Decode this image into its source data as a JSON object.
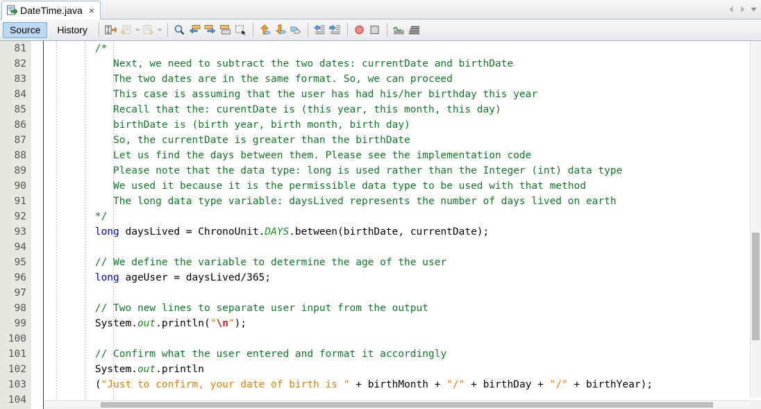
{
  "window": {
    "tab": {
      "label": "DateTime.java",
      "icon": "java-file-icon",
      "close_label": "×"
    },
    "tab_nav": {
      "prev_icon": "chevron-left-icon",
      "next_icon": "chevron-right-icon",
      "list_icon": "tab-list-chevron-icon"
    }
  },
  "toolbar": {
    "view_tabs": [
      {
        "label": "Source",
        "selected": true
      },
      {
        "label": "History",
        "selected": false
      }
    ],
    "buttons": [
      {
        "name": "toggle-rectangular-selection-icon",
        "enabled": true
      },
      {
        "name": "back-icon",
        "enabled": false
      },
      {
        "name": "back-dropdown-caret-icon",
        "enabled": false
      },
      {
        "name": "forward-icon",
        "enabled": false
      },
      {
        "name": "forward-dropdown-caret-icon",
        "enabled": false
      },
      {
        "name": "find-selection-icon",
        "enabled": true
      },
      {
        "name": "find-previous-icon",
        "enabled": true
      },
      {
        "name": "find-next-icon",
        "enabled": true
      },
      {
        "name": "toggle-highlight-icon",
        "enabled": true
      },
      {
        "name": "previous-bookmark-icon",
        "enabled": true
      },
      {
        "name": "next-bookmark-icon",
        "enabled": true
      },
      {
        "name": "toggle-bookmark-icon",
        "enabled": true
      },
      {
        "name": "shift-line-left-icon",
        "enabled": true
      },
      {
        "name": "shift-line-right-icon",
        "enabled": true
      },
      {
        "name": "start-macro-recording-icon",
        "enabled": true
      },
      {
        "name": "stop-macro-recording-icon",
        "enabled": true
      },
      {
        "name": "inspect-members-icon",
        "enabled": true
      },
      {
        "name": "inspect-hierarchy-icon",
        "enabled": true
      }
    ]
  },
  "editor": {
    "first_line": 81,
    "lines": [
      {
        "n": "81",
        "tokens": [
          {
            "t": "        ",
            "c": ""
          },
          {
            "t": "/*",
            "c": "c-comment"
          }
        ]
      },
      {
        "n": "82",
        "tokens": [
          {
            "t": "           Next, we need to subtract the two dates: currentDate and birthDate",
            "c": "c-comment"
          }
        ]
      },
      {
        "n": "83",
        "tokens": [
          {
            "t": "           The two dates are in the same format. So, we can proceed",
            "c": "c-comment"
          }
        ]
      },
      {
        "n": "84",
        "tokens": [
          {
            "t": "           This case is assuming that the user has had his/her birthday this year",
            "c": "c-comment"
          }
        ]
      },
      {
        "n": "85",
        "tokens": [
          {
            "t": "           Recall that the: curentDate is (this year, this month, this day)",
            "c": "c-comment"
          }
        ]
      },
      {
        "n": "86",
        "tokens": [
          {
            "t": "           birthDate is (birth year, birth month, birth day)",
            "c": "c-comment"
          }
        ]
      },
      {
        "n": "87",
        "tokens": [
          {
            "t": "           So, the currentDate is greater than the birthDate",
            "c": "c-comment"
          }
        ]
      },
      {
        "n": "88",
        "tokens": [
          {
            "t": "           Let us find the days between them. Please see the implementation code",
            "c": "c-comment"
          }
        ]
      },
      {
        "n": "89",
        "tokens": [
          {
            "t": "           Please note that the data type: long is used rather than the Integer (int) data type",
            "c": "c-comment"
          }
        ]
      },
      {
        "n": "90",
        "tokens": [
          {
            "t": "           We used it because it is the permissible data type to be used with that method",
            "c": "c-comment"
          }
        ]
      },
      {
        "n": "91",
        "tokens": [
          {
            "t": "           The long data type variable: daysLived represents the number of days lived on earth",
            "c": "c-comment"
          }
        ]
      },
      {
        "n": "92",
        "tokens": [
          {
            "t": "        ",
            "c": ""
          },
          {
            "t": "*/",
            "c": "c-comment"
          }
        ]
      },
      {
        "n": "93",
        "tokens": [
          {
            "t": "        ",
            "c": ""
          },
          {
            "t": "long",
            "c": "c-kw"
          },
          {
            "t": " daysLived = ChronoUnit.",
            "c": ""
          },
          {
            "t": "DAYS",
            "c": "c-static"
          },
          {
            "t": ".between(birthDate, currentDate);",
            "c": ""
          }
        ]
      },
      {
        "n": "94",
        "tokens": []
      },
      {
        "n": "95",
        "tokens": [
          {
            "t": "        ",
            "c": ""
          },
          {
            "t": "// We define the variable to determine the age of the user",
            "c": "c-comment"
          }
        ]
      },
      {
        "n": "96",
        "tokens": [
          {
            "t": "        ",
            "c": ""
          },
          {
            "t": "long",
            "c": "c-kw"
          },
          {
            "t": " ageUser = daysLived/365;",
            "c": ""
          }
        ]
      },
      {
        "n": "97",
        "tokens": []
      },
      {
        "n": "98",
        "tokens": [
          {
            "t": "        ",
            "c": ""
          },
          {
            "t": "// Two new lines to separate user input from the output",
            "c": "c-comment"
          }
        ]
      },
      {
        "n": "99",
        "tokens": [
          {
            "t": "        System.",
            "c": ""
          },
          {
            "t": "out",
            "c": "c-static"
          },
          {
            "t": ".println(",
            "c": ""
          },
          {
            "t": "\"",
            "c": "c-str"
          },
          {
            "t": "\\n",
            "c": "c-esc"
          },
          {
            "t": "\"",
            "c": "c-str"
          },
          {
            "t": ");",
            "c": ""
          }
        ]
      },
      {
        "n": "100",
        "tokens": []
      },
      {
        "n": "101",
        "tokens": [
          {
            "t": "        ",
            "c": ""
          },
          {
            "t": "// Confirm what the user entered and format it accordingly",
            "c": "c-comment"
          }
        ]
      },
      {
        "n": "102",
        "tokens": [
          {
            "t": "        System.",
            "c": ""
          },
          {
            "t": "out",
            "c": "c-static"
          },
          {
            "t": ".println",
            "c": ""
          }
        ]
      },
      {
        "n": "103",
        "tokens": [
          {
            "t": "        (",
            "c": ""
          },
          {
            "t": "\"Just to confirm, your date of birth is \"",
            "c": "c-str"
          },
          {
            "t": " + birthMonth + ",
            "c": ""
          },
          {
            "t": "\"/\"",
            "c": "c-str"
          },
          {
            "t": " + birthDay + ",
            "c": ""
          },
          {
            "t": "\"/\"",
            "c": "c-str"
          },
          {
            "t": " + birthYear);",
            "c": ""
          }
        ]
      },
      {
        "n": "104",
        "tokens": []
      }
    ]
  },
  "scrollbars": {
    "vertical": {
      "thumb_top_pct": 53,
      "thumb_height_pct": 30
    },
    "horizontal": {
      "thumb_left_pct": 8,
      "thumb_width_pct": 86
    }
  },
  "colors": {
    "comment": "#0f7a24",
    "keyword": "#0000cc",
    "string": "#e08000",
    "escape": "#cc2020",
    "static_field": "#1a8c1a",
    "plain": "#000000",
    "gutter_bg": "#e8e8e2",
    "selected_tab_bg": "#bcd8f2",
    "editor_bg": "#ffffff"
  }
}
